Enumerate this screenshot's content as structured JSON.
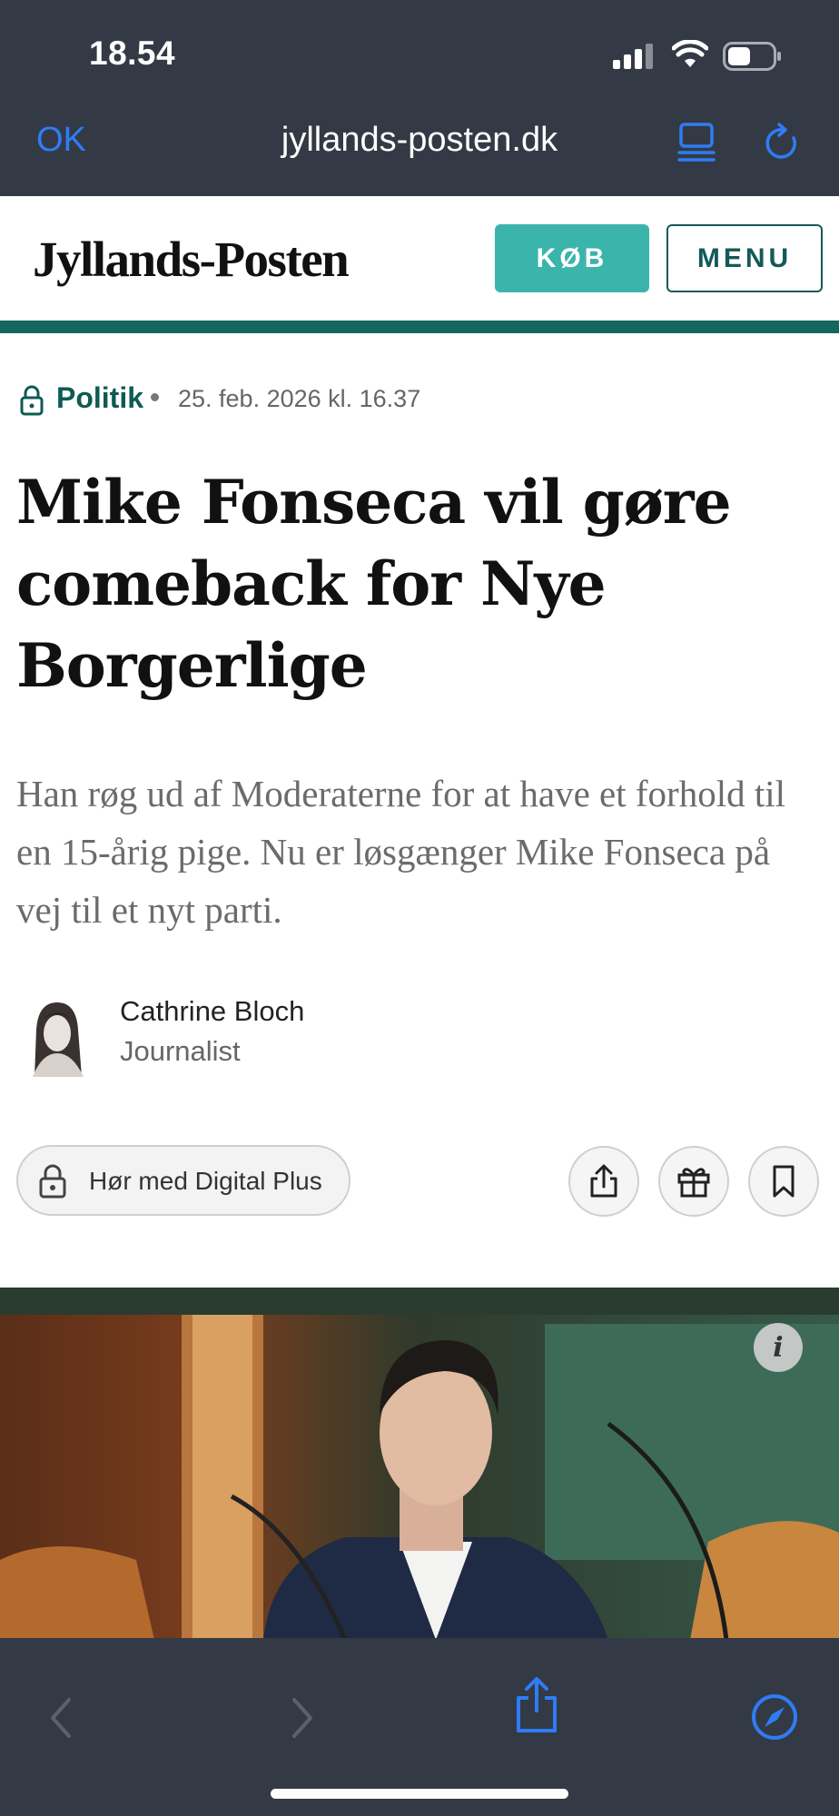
{
  "status_bar": {
    "time": "18.54"
  },
  "browser": {
    "done_label": "OK",
    "url": "jyllands-posten.dk",
    "tabs_icon": "tabs-icon",
    "reload_icon": "reload-icon",
    "back_icon": "back-chevron-icon",
    "forward_icon": "forward-chevron-icon",
    "share_icon": "share-icon",
    "safari_icon": "compass-icon"
  },
  "site": {
    "logo": "Jyllands-Posten",
    "buy_label": "KØB",
    "menu_label": "MENU",
    "accent": "#3bb5ac",
    "brand_dark": "#14675e"
  },
  "article": {
    "section": "Politik",
    "date": "25. feb. 2026 kl. 16.37",
    "headline": "Mike Fonseca vil gøre comeback for Nye Borgerlige",
    "lead": "Han røg ud af Moderaterne for at have et forhold til en 15-årig pige. Nu er løsgænger Mike Fonseca på vej til et nyt parti.",
    "author": {
      "name": "Cathrine Bloch",
      "role": "Journalist"
    },
    "listen_label": "Hør med Digital Plus",
    "actions": [
      "share-icon",
      "gift-icon",
      "bookmark-icon"
    ],
    "image_info": "i"
  }
}
